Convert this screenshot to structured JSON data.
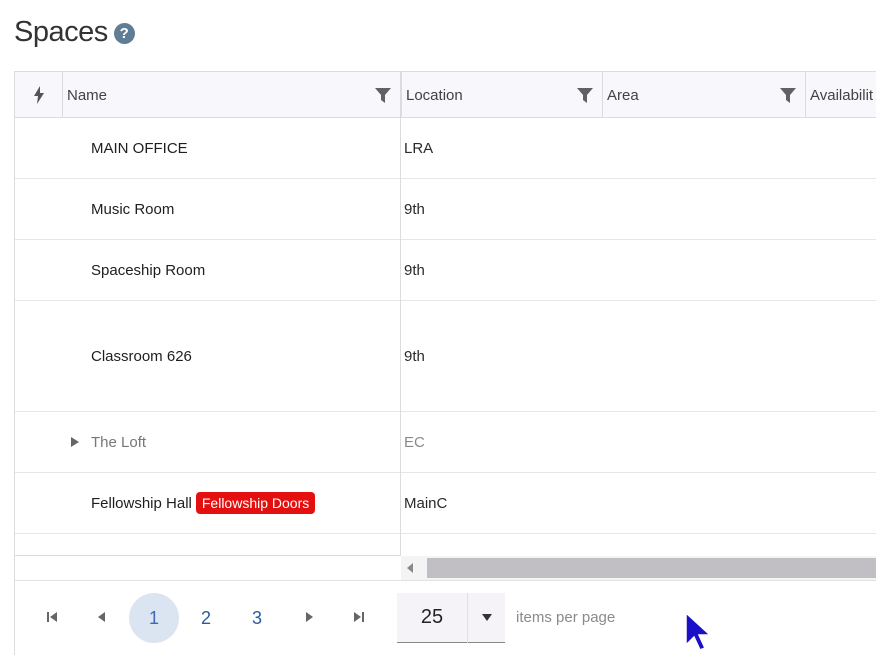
{
  "page": {
    "title": "Spaces",
    "help_icon": "question-circle-icon"
  },
  "grid": {
    "columns": [
      {
        "key": "actions",
        "label": "",
        "icon": "lightning-icon"
      },
      {
        "key": "name",
        "label": "Name",
        "filter_icon": "filter-icon"
      },
      {
        "key": "location",
        "label": "Location",
        "filter_icon": "filter-icon"
      },
      {
        "key": "area",
        "label": "Area",
        "filter_icon": "filter-icon"
      },
      {
        "key": "availability",
        "label": "Availabilit"
      }
    ],
    "rows": [
      {
        "name": "MAIN OFFICE",
        "location": "LRA"
      },
      {
        "name": "Music Room",
        "location": "9th"
      },
      {
        "name": "Spaceship Room",
        "location": "9th"
      },
      {
        "name": "Classroom 626",
        "location": "9th"
      },
      {
        "name": "The Loft",
        "location": "EC",
        "expandable": true
      },
      {
        "name": "Fellowship Hall",
        "location": "MainC",
        "badge": "Fellowship Doors"
      }
    ]
  },
  "pager": {
    "first_icon": "first-page-icon",
    "prev_icon": "prev-page-icon",
    "pages": [
      "1",
      "2",
      "3"
    ],
    "current_page": "1",
    "next_icon": "next-page-icon",
    "last_icon": "last-page-icon",
    "page_size": "25",
    "items_per_page_label": "items per page"
  },
  "colors": {
    "badge": "#e40f0f",
    "active_page_bg": "#dbe4f1",
    "page_link": "#2c5aa0",
    "cursor": "#1a10c8"
  }
}
